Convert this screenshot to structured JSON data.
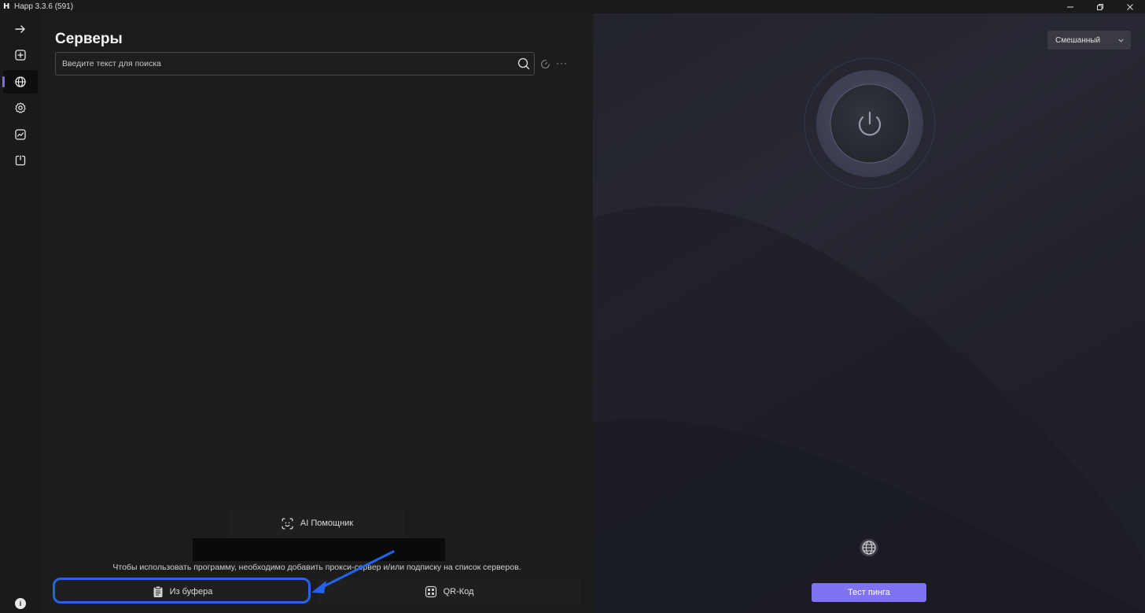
{
  "window": {
    "title": "Happ 3.3.6 (591)",
    "controls": [
      "minimize-icon",
      "restore-icon",
      "close-icon"
    ]
  },
  "sidebar": {
    "items": [
      {
        "icon": "arrow-right-icon"
      },
      {
        "icon": "add-square-icon"
      },
      {
        "icon": "globe-icon",
        "active": true
      },
      {
        "icon": "gear-icon"
      },
      {
        "icon": "chart-icon"
      },
      {
        "icon": "export-icon"
      }
    ],
    "info_label": "i"
  },
  "servers": {
    "title": "Серверы",
    "search_placeholder": "Введите текст для поиска",
    "more_label": "···",
    "ai_button_label": "AI Помощник",
    "hint": "Чтобы использовать программу, необходимо добавить прокси-сервер и/или подписку на список серверов.",
    "clipboard_button_label": "Из буфера",
    "qr_button_label": "QR-Код"
  },
  "connection": {
    "mode_value": "Смешанный",
    "ping_button_label": "Тест пинга"
  },
  "colors": {
    "accent": "#7f73f2",
    "highlight": "#2563eb"
  }
}
